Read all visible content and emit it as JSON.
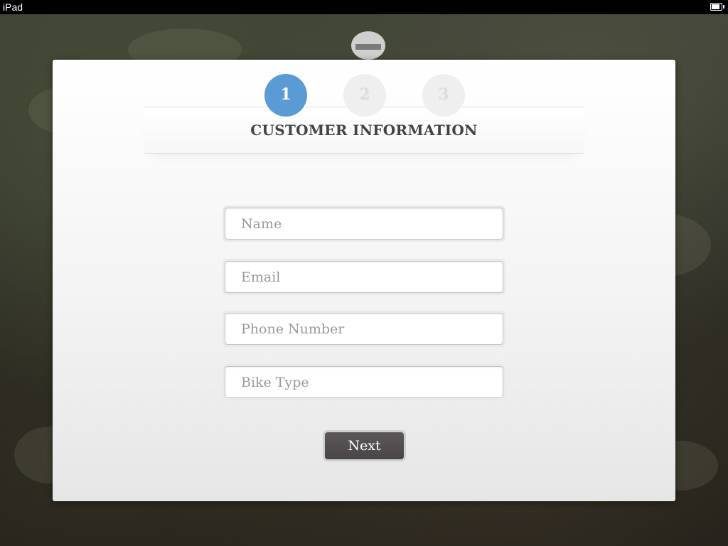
{
  "status_bar": {
    "device_name": "iPad",
    "battery_icon": "battery-icon"
  },
  "wizard": {
    "steps": [
      {
        "number": "1",
        "state": "active",
        "color": "#5b9bd5"
      },
      {
        "number": "2",
        "state": "inactive"
      },
      {
        "number": "3",
        "state": "inactive"
      }
    ],
    "section_title": "CUSTOMER INFORMATION"
  },
  "form": {
    "name_placeholder": "Name",
    "email_placeholder": "Email",
    "phone_placeholder": "Phone Number",
    "bike_type_placeholder": "Bike Type",
    "name_value": "",
    "email_value": "",
    "phone_value": "",
    "bike_type_value": ""
  },
  "actions": {
    "next_label": "Next"
  },
  "colors": {
    "accent": "#5b9bd5",
    "button": "#524e4f"
  }
}
